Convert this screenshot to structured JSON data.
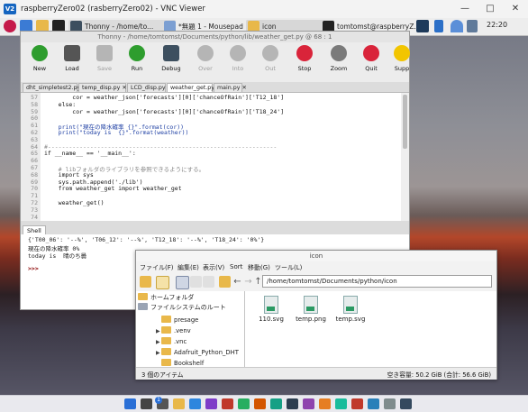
{
  "vnc": {
    "logo": "V2",
    "title": "raspberryZero02 (rasberryZero02) - VNC Viewer",
    "controls": [
      "minimize-icon",
      "maximize-icon",
      "close-icon"
    ]
  },
  "pi_taskbar": {
    "tasks": [
      {
        "label": "Thonny - /home/to..."
      },
      {
        "label": "*無題 1 - Mousepad"
      },
      {
        "label": "icon"
      },
      {
        "label": "tomtomst@raspberryZ..."
      }
    ],
    "clock": "22:20"
  },
  "thonny": {
    "title": "Thonny - /home/tomtomst/Documents/python/lib/weather_get.py @ 68 : 1",
    "toolbar": [
      {
        "label": "New",
        "color": "#2e9d2e",
        "enabled": true
      },
      {
        "label": "Load",
        "color": "#555555",
        "enabled": true
      },
      {
        "label": "Save",
        "color": "#b5b5b5",
        "enabled": false
      },
      {
        "label": "Run",
        "color": "#2e9d2e",
        "enabled": true
      },
      {
        "label": "Debug",
        "color": "#3d4f5f",
        "enabled": true
      },
      {
        "label": "Over",
        "color": "#b5b5b5",
        "enabled": false
      },
      {
        "label": "Into",
        "color": "#b5b5b5",
        "enabled": false
      },
      {
        "label": "Out",
        "color": "#b5b5b5",
        "enabled": false
      },
      {
        "label": "Stop",
        "color": "#d9243a",
        "enabled": true
      },
      {
        "label": "Zoom",
        "color": "#7a7a7a",
        "enabled": true
      },
      {
        "label": "Quit",
        "color": "#d9243a",
        "enabled": true
      },
      {
        "label": "Supp",
        "color": "#f2c500",
        "enabled": true
      }
    ],
    "tabs": [
      {
        "label": "dht_simpletest2.py ✕",
        "active": false
      },
      {
        "label": "temp_disp.py ✕",
        "active": false
      },
      {
        "label": "LCD_disp.py ✕",
        "active": false
      },
      {
        "label": "weather_get.py ✕",
        "active": true
      },
      {
        "label": "main.py ✕",
        "active": false
      }
    ],
    "code_lines": [
      {
        "n": "57",
        "text": "        cor = weather_json['forecasts'][0]['chanceOfRain']['T12_18']"
      },
      {
        "n": "58",
        "text": "    else:"
      },
      {
        "n": "59",
        "text": "        cor = weather_json['forecasts'][0]['chanceOfRain']['T18_24']"
      },
      {
        "n": "60",
        "text": ""
      },
      {
        "n": "61",
        "text": "    print(\"現在の降水確率 {}\".format(cor))"
      },
      {
        "n": "62",
        "text": "    print(\"today is  {}\".format(weather))"
      },
      {
        "n": "63",
        "text": ""
      },
      {
        "n": "64",
        "text": "#-----------------------------------------------------------------"
      },
      {
        "n": "65",
        "text": "if __name__ == '__main__':"
      },
      {
        "n": "66",
        "text": ""
      },
      {
        "n": "67",
        "text": "    # libフォルダのライブラリを参照できるようにする。"
      },
      {
        "n": "68",
        "text": "    import sys"
      },
      {
        "n": "69",
        "text": "    sys.path.append('./lib')"
      },
      {
        "n": "70",
        "text": "    from weather_get import weather_get"
      },
      {
        "n": "71",
        "text": ""
      },
      {
        "n": "72",
        "text": "    weather_get()"
      },
      {
        "n": "73",
        "text": ""
      },
      {
        "n": "74",
        "text": ""
      },
      {
        "n": "75",
        "text": ""
      }
    ],
    "shell_tab": "Shell",
    "shell_lines": [
      "{'T00_06': '--%', 'T06_12': '--%', 'T12_18': '--%', 'T18_24': '0%'}",
      "現在の降水確率 0%",
      "today is  晴のち曇",
      "",
      ">>>"
    ]
  },
  "file_manager": {
    "title": "icon",
    "menu": [
      "ファイル(F)",
      "編集(E)",
      "表示(V)",
      "Sort",
      "移動(G)",
      "ツール(L)"
    ],
    "path": "/home/tomtomst/Documents/python/icon",
    "side_places": [
      "ホームフォルダ",
      "ファイルシステムのルート"
    ],
    "tree": [
      {
        "label": "presage",
        "expandable": false
      },
      {
        "label": ".venv",
        "expandable": true
      },
      {
        "label": ".vnc",
        "expandable": true
      },
      {
        "label": "Adafruit_Python_DHT",
        "expandable": true
      },
      {
        "label": "Bookshelf",
        "expandable": false
      }
    ],
    "files": [
      "110.svg",
      "temp.png",
      "temp.svg"
    ],
    "status_left": "3 個のアイテム",
    "status_right": "空き容量: 50.2 GiB (合計: 56.6 GiB)"
  },
  "win_taskbar": {
    "icons": [
      "start-icon",
      "search-icon",
      "task-view-icon",
      "explorer-icon",
      "browser-icon",
      "app-icon",
      "app-icon",
      "app-icon",
      "app-icon",
      "app-icon",
      "app-icon",
      "app-icon",
      "app-icon",
      "app-icon",
      "app-icon",
      "app-icon",
      "app-icon",
      "app-icon"
    ],
    "badge": "1"
  }
}
